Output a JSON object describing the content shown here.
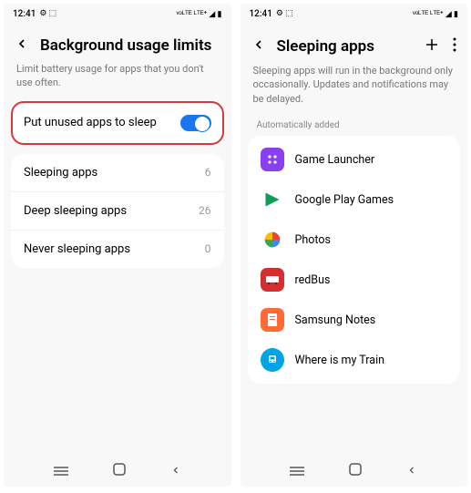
{
  "status": {
    "time": "12:41",
    "indicators": "⚙ ⬚",
    "right": "ᵛᵒᴸᵀᴱ ᴸᵀᴱ⁺ ◢ ▮"
  },
  "left_screen": {
    "title": "Background usage limits",
    "subtitle": "Limit battery usage for apps that you don't use often.",
    "toggle_label": "Put unused apps to sleep",
    "items": [
      {
        "label": "Sleeping apps",
        "count": "6"
      },
      {
        "label": "Deep sleeping apps",
        "count": "26"
      },
      {
        "label": "Never sleeping apps",
        "count": "0"
      }
    ]
  },
  "right_screen": {
    "title": "Sleeping apps",
    "subtitle": "Sleeping apps will run in the background only occasionally. Updates and notifications may be delayed.",
    "section": "Automatically added",
    "apps": [
      {
        "name": "Game Launcher",
        "bg": "#8a3ff0",
        "icon": "game-launcher"
      },
      {
        "name": "Google Play Games",
        "bg": "#fff",
        "icon": "play-games"
      },
      {
        "name": "Photos",
        "bg": "#fff",
        "icon": "photos"
      },
      {
        "name": "redBus",
        "bg": "#d32f2f",
        "icon": "redbus"
      },
      {
        "name": "Samsung Notes",
        "bg": "#ff6b35",
        "icon": "samsung-notes"
      },
      {
        "name": "Where is my Train",
        "bg": "#00a4e4",
        "icon": "train"
      }
    ]
  }
}
